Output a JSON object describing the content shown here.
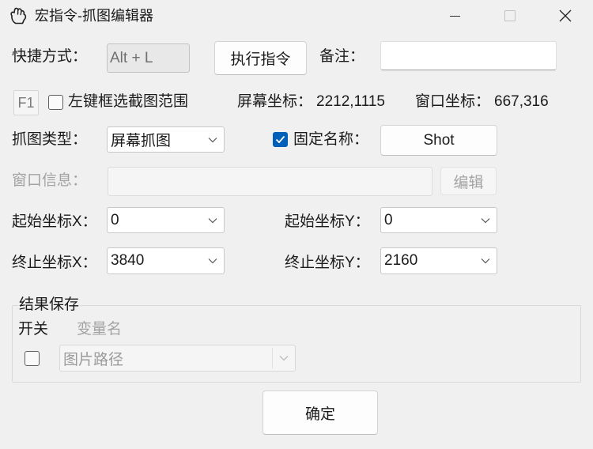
{
  "window": {
    "title": "宏指令-抓图编辑器",
    "icons": {
      "app": "hand-pointer-icon",
      "minimize": "minimize-icon",
      "maximize": "maximize-icon",
      "close": "close-icon"
    }
  },
  "shortcut": {
    "label": "快捷方式：",
    "value": "Alt + L"
  },
  "execute_button": {
    "label": "执行指令"
  },
  "remark": {
    "label": "备注：",
    "value": ""
  },
  "region_select": {
    "hotkey": "F1",
    "checkbox_label": "左键框选截图范围",
    "checked": false
  },
  "coordinates": {
    "screen_label": "屏幕坐标：",
    "screen_value": "2212,1115",
    "window_label": "窗口坐标：",
    "window_value": "667,316"
  },
  "capture_type": {
    "label": "抓图类型：",
    "selected": "屏幕抓图"
  },
  "fixed_name": {
    "label": "固定名称：",
    "checked": true,
    "button_label": "Shot"
  },
  "window_info": {
    "label": "窗口信息：",
    "value": "",
    "edit_button": "编辑",
    "enabled": false
  },
  "start_x": {
    "label": "起始坐标X：",
    "selected": "0"
  },
  "start_y": {
    "label": "起始坐标Y：",
    "selected": "0"
  },
  "end_x": {
    "label": "终止坐标X：",
    "selected": "3840"
  },
  "end_y": {
    "label": "终止坐标Y：",
    "selected": "2160"
  },
  "result_save": {
    "legend": "结果保存",
    "switch_label": "开关",
    "switch_checked": false,
    "variable_label": "变量名",
    "variable_selected": "图片路径",
    "variable_enabled": false
  },
  "ok_button": {
    "label": "确定"
  },
  "colors": {
    "window_bg": "#f0f0f0",
    "accent": "#005fb8",
    "text": "#1b1b1b",
    "disabled_text": "#a3a3a3"
  }
}
